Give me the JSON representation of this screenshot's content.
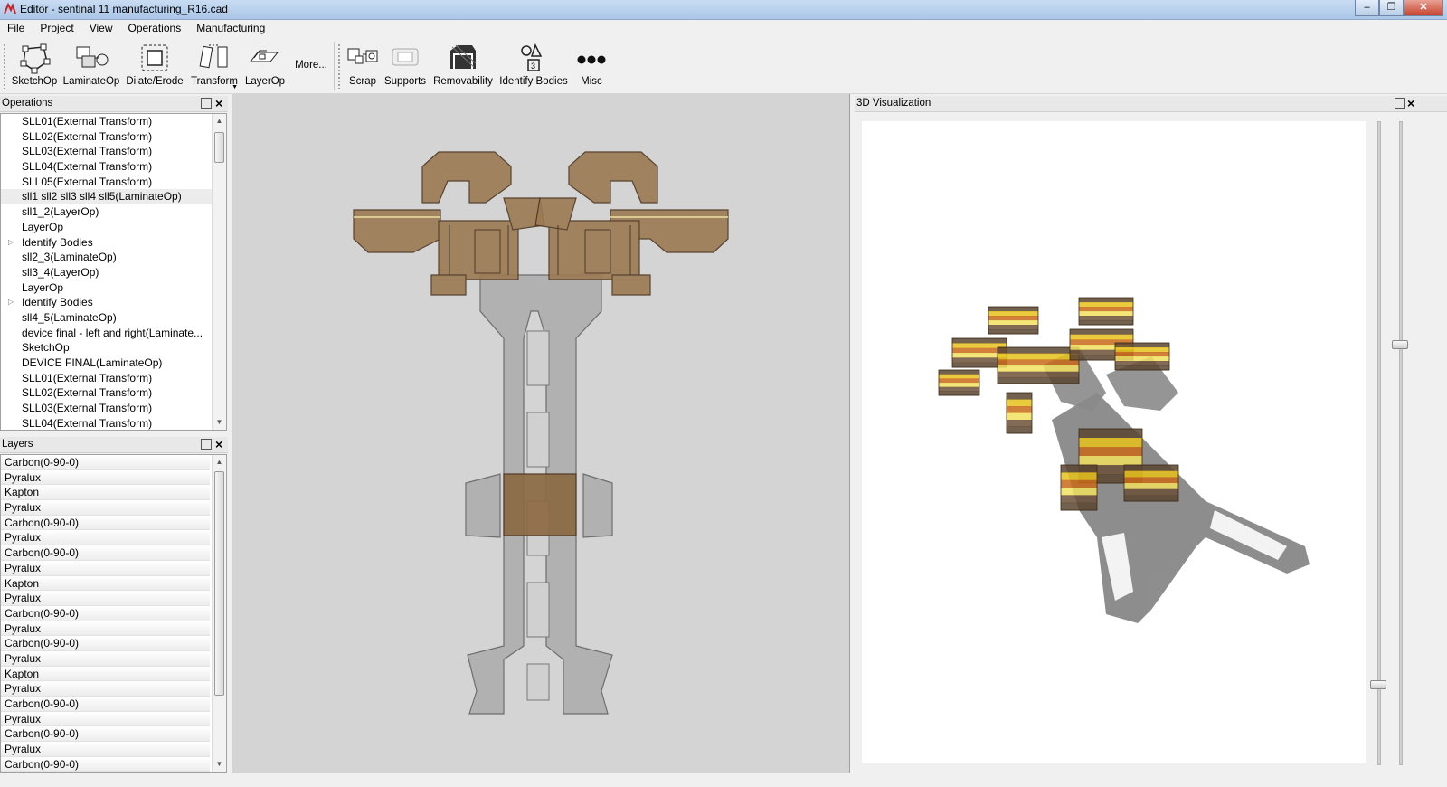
{
  "window": {
    "title": "Editor - sentinal 11 manufacturing_R16.cad",
    "min": "–",
    "max": "❐",
    "close": "✕"
  },
  "menubar": [
    "File",
    "Project",
    "View",
    "Operations",
    "Manufacturing"
  ],
  "toolbar": {
    "sketchop": "SketchOp",
    "laminateop": "LaminateOp",
    "dilate": "Dilate/Erode",
    "transform": "Transform",
    "layerop": "LayerOp",
    "more": "More...",
    "scrap": "Scrap",
    "supports": "Supports",
    "removability": "Removability",
    "identify": "Identify Bodies",
    "misc": "Misc"
  },
  "operations_panel": {
    "title": "Operations",
    "items": [
      "SLL01(External Transform)",
      "SLL02(External Transform)",
      "SLL03(External Transform)",
      "SLL04(External Transform)",
      "SLL05(External Transform)",
      "sll1 sll2 sll3 sll4 sll5(LaminateOp)",
      "sll1_2(LayerOp)",
      "LayerOp",
      "Identify Bodies",
      "sll2_3(LaminateOp)",
      "sll3_4(LayerOp)",
      "LayerOp",
      "Identify Bodies",
      "sll4_5(LaminateOp)",
      "device final -  left and right(Laminate...",
      "SketchOp",
      "DEVICE FINAL(LaminateOp)",
      "SLL01(External Transform)",
      "SLL02(External Transform)",
      "SLL03(External Transform)",
      "SLL04(External Transform)"
    ]
  },
  "layers_panel": {
    "title": "Layers",
    "items": [
      "Carbon(0-90-0)",
      "Pyralux",
      "Kapton",
      "Pyralux",
      "Carbon(0-90-0)",
      "Pyralux",
      "Carbon(0-90-0)",
      "Pyralux",
      "Kapton",
      "Pyralux",
      "Carbon(0-90-0)",
      "Pyralux",
      "Carbon(0-90-0)",
      "Pyralux",
      "Kapton",
      "Pyralux",
      "Carbon(0-90-0)",
      "Pyralux",
      "Carbon(0-90-0)",
      "Pyralux",
      "Carbon(0-90-0)"
    ]
  },
  "viz_panel": {
    "title": "3D Visualization"
  },
  "colors": {
    "bronze": "#8c6a44",
    "gray_part": "#a8a8a8",
    "yellow": "#e8c21c",
    "orange": "#c96a1a"
  }
}
